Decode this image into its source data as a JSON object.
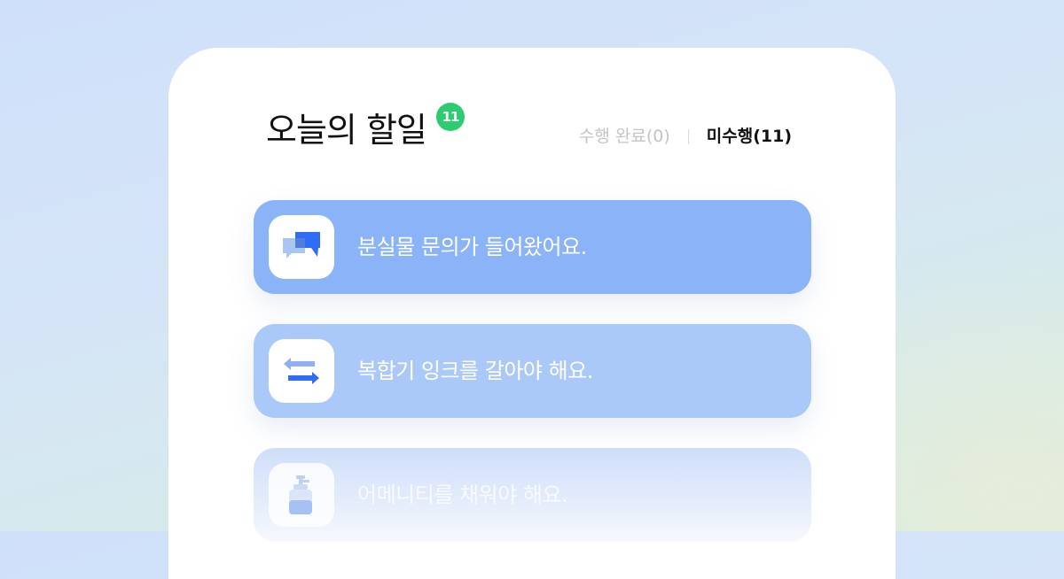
{
  "header": {
    "title": "오늘의 할일",
    "badge_count": "11"
  },
  "filters": {
    "completed_label": "수행 완료(0)",
    "pending_label": "미수행(11)"
  },
  "tasks": [
    {
      "label": "분실물 문의가 들어왔어요.",
      "icon": "chat-bubbles-icon"
    },
    {
      "label": "복합기 잉크를 갈아야 해요.",
      "icon": "swap-arrows-icon"
    },
    {
      "label": "어메니티를 채워야 해요.",
      "icon": "pump-bottle-icon"
    }
  ],
  "colors": {
    "badge_green": "#2ecc71",
    "task_primary": "#8ab3f8",
    "task_secondary": "#abc9f8",
    "icon_blue": "#2f6df6"
  }
}
